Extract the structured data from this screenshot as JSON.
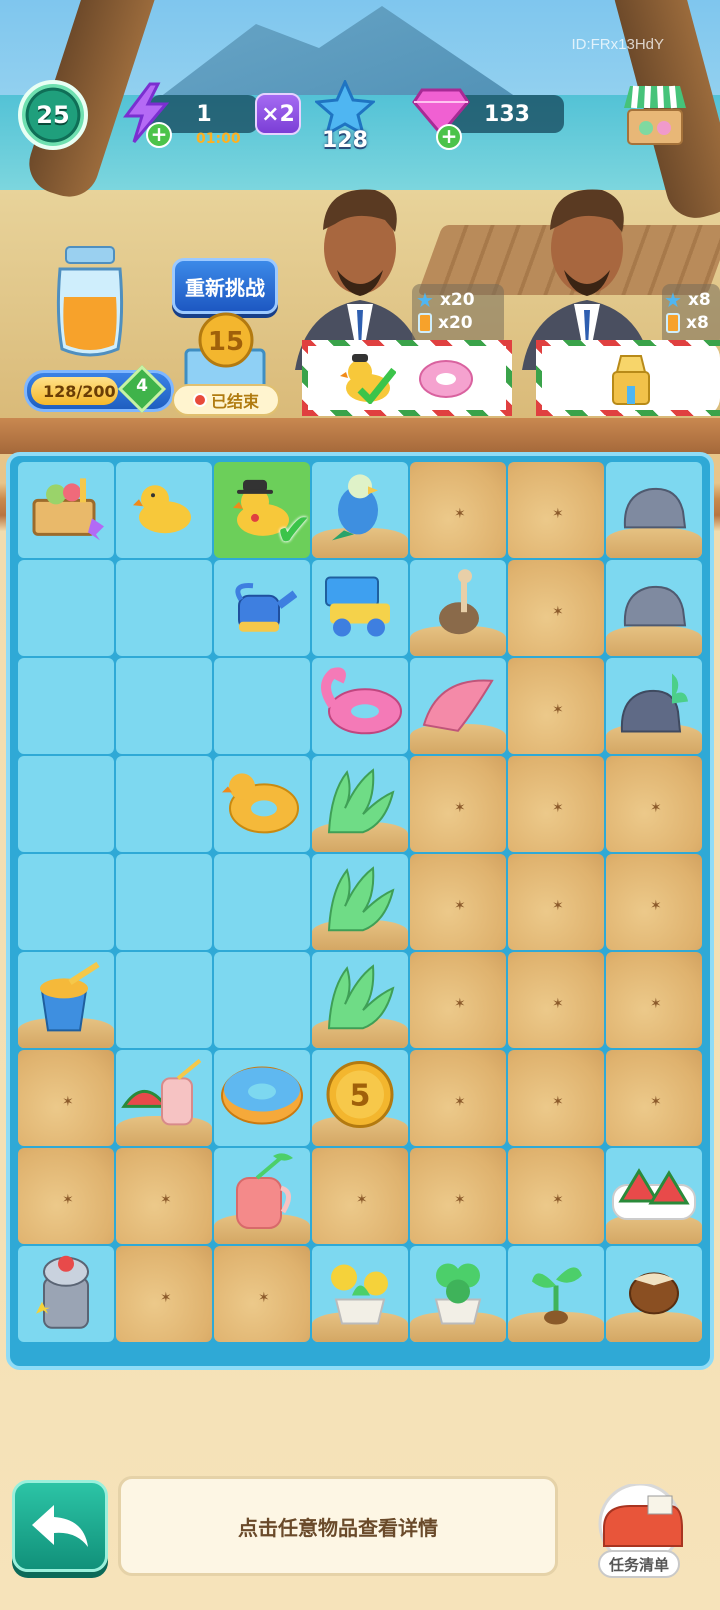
{
  "header": {
    "player_id": "ID:FRx13HdY",
    "level": "25",
    "energy": "1",
    "energy_timer": "01:00",
    "multiplier": "×2",
    "stars": "128",
    "gems": "133",
    "icons": [
      "level-badge-icon",
      "energy-bolt-icon",
      "star-icon",
      "gem-icon",
      "shop-icon"
    ]
  },
  "left_panel": {
    "jar_progress": "128/200",
    "jar_progress_fraction": 0.64,
    "jar_level": "4",
    "retry_label": "重新挑战",
    "coin_value": "15",
    "ended_label": "已结束"
  },
  "customers": [
    {
      "requirements": [
        {
          "icon": "star-icon",
          "text": "x20"
        },
        {
          "icon": "juice-icon",
          "text": "x20"
        }
      ],
      "order_items": [
        "duck-with-hat-icon",
        "donut-float-icon"
      ],
      "completed_first": true
    },
    {
      "requirements": [
        {
          "icon": "star-icon",
          "text": "x8"
        },
        {
          "icon": "juice-icon",
          "text": "x8"
        }
      ],
      "order_items": [
        "sandcastle-icon"
      ],
      "completed_first": false
    }
  ],
  "board": {
    "rows": [
      [
        "basket",
        "duck",
        "duck-hat",
        "parrot",
        "sand",
        "sand",
        "rock"
      ],
      [
        "empty",
        "empty",
        "watering-can",
        "toy-truck",
        "ostrich",
        "sand",
        "rock"
      ],
      [
        "empty",
        "empty",
        "empty",
        "flamingo",
        "shell",
        "sand",
        "rock-plant"
      ],
      [
        "empty",
        "empty",
        "duck-ring",
        "grass",
        "sand",
        "sand",
        "sand"
      ],
      [
        "empty",
        "empty",
        "empty",
        "grass",
        "sand",
        "sand",
        "sand"
      ],
      [
        "sand-bucket",
        "empty",
        "empty",
        "grass",
        "sand",
        "sand",
        "sand"
      ],
      [
        "sand",
        "watermelon-juice",
        "donut-float",
        "coin5",
        "sand",
        "sand",
        "sand"
      ],
      [
        "sand",
        "sand",
        "juice-jug",
        "sand",
        "sand",
        "sand",
        "watermelon-slices"
      ],
      [
        "juicer",
        "sand",
        "sand",
        "flower-pot",
        "clover-pot",
        "sprout",
        "seed"
      ]
    ],
    "coin_label": "5"
  },
  "footer": {
    "hint": "点击任意物品查看详情",
    "task_label": "任务清单"
  }
}
